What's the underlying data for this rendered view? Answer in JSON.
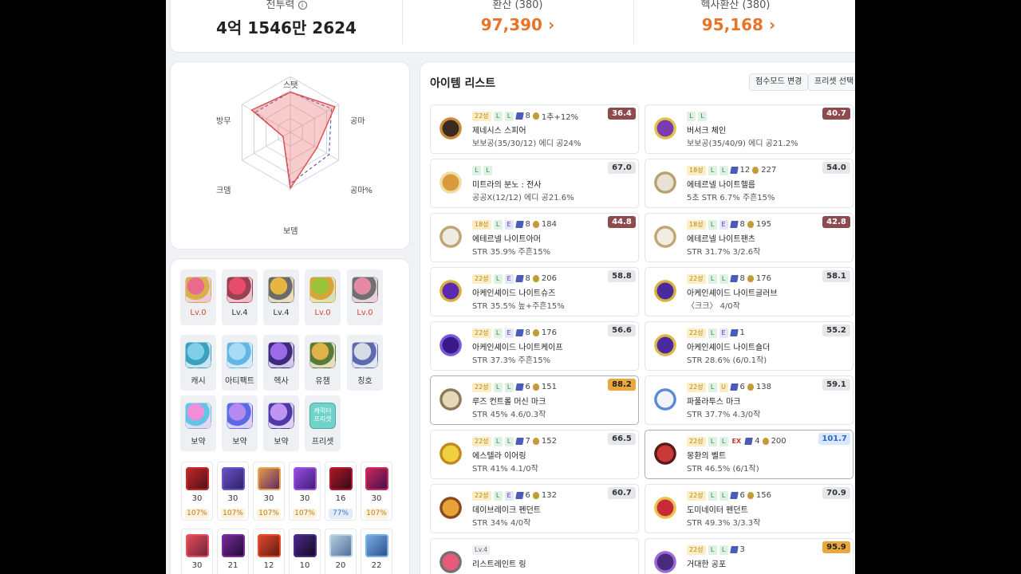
{
  "stats": [
    {
      "label": "전투력",
      "value": "4억 1546만 2624",
      "color": "dark",
      "info_icon": "info-circle-icon"
    },
    {
      "label": "환산 (380)",
      "value": "97,390",
      "color": "orange"
    },
    {
      "label": "헥사환산 (380)",
      "value": "95,168",
      "color": "orange"
    }
  ],
  "radar": {
    "axes": [
      "스탯",
      "공마",
      "공마%",
      "보뎀",
      "크뎀",
      "방무"
    ]
  },
  "equip_slots": [
    {
      "caption": "Lv.0",
      "color": "red",
      "icon": "ring-icon",
      "c1": "#e86a8c",
      "c2": "#d8b04a"
    },
    {
      "caption": "Lv.4",
      "color": "",
      "icon": "ring-icon",
      "c1": "#e54d6b",
      "c2": "#9a4052"
    },
    {
      "caption": "Lv.4",
      "color": "",
      "icon": "ring-icon",
      "c1": "#e6b640",
      "c2": "#6b6b6b"
    },
    {
      "caption": "Lv.0",
      "color": "red",
      "icon": "ring-icon",
      "c1": "#9ac53b",
      "c2": "#d8a53a"
    },
    {
      "caption": "Lv.0",
      "color": "red",
      "icon": "ring-icon",
      "c1": "#e58aa4",
      "c2": "#707070"
    },
    {
      "caption": "캐시",
      "color": "",
      "icon": "cash-icon",
      "c1": "#7fd0e6",
      "c2": "#3aa0c0"
    },
    {
      "caption": "아티팩트",
      "color": "",
      "icon": "artifact-icon",
      "c1": "#a8dcf6",
      "c2": "#62b6e3"
    },
    {
      "caption": "헥사",
      "color": "",
      "icon": "hexa-icon",
      "c1": "#9a6ae8",
      "c2": "#3b2b7a"
    },
    {
      "caption": "유챔",
      "color": "",
      "icon": "champion-icon",
      "c1": "#e0b24a",
      "c2": "#5a7a3a"
    },
    {
      "caption": "칭호",
      "color": "",
      "icon": "title-icon",
      "c1": "#d6dbe6",
      "c2": "#5d6ab0"
    },
    {
      "caption": "보약",
      "color": "",
      "icon": "potion-icon",
      "c1": "#f18ed9",
      "c2": "#5ec7e8"
    },
    {
      "caption": "보약",
      "color": "",
      "icon": "potion-icon",
      "c1": "#b58af0",
      "c2": "#5a6ae6"
    },
    {
      "caption": "보약",
      "color": "",
      "icon": "potion-icon",
      "c1": "#c094f0",
      "c2": "#4d3aa8"
    },
    {
      "caption": "프리셋",
      "color": "",
      "icon": "preset-icon",
      "c1": "#6fd3c9",
      "c2": "#4fa7a8",
      "text": "캐릭터 프리셋"
    }
  ],
  "skills": [
    {
      "lv": "30",
      "pct": "107%",
      "pc": "y",
      "c1": "#c6292b",
      "c2": "#4b0f13"
    },
    {
      "lv": "30",
      "pct": "107%",
      "pc": "y",
      "c1": "#6b55c9",
      "c2": "#2a1d63"
    },
    {
      "lv": "30",
      "pct": "107%",
      "pc": "y",
      "c1": "#e8a34b",
      "c2": "#5a1f63"
    },
    {
      "lv": "30",
      "pct": "107%",
      "pc": "y",
      "c1": "#9b4fe3",
      "c2": "#3a1a74"
    },
    {
      "lv": "16",
      "pct": "77%",
      "pc": "b",
      "c1": "#b5182d",
      "c2": "#2a0a12"
    },
    {
      "lv": "30",
      "pct": "107%",
      "pc": "y",
      "c1": "#cf2a5a",
      "c2": "#3b0e4f"
    },
    {
      "lv": "30",
      "c1": "#e8505a",
      "c2": "#6a1f3a"
    },
    {
      "lv": "21",
      "c1": "#7b2b9e",
      "c2": "#1e0b33"
    },
    {
      "lv": "12",
      "c1": "#e84a2a",
      "c2": "#5a1a12"
    },
    {
      "lv": "10",
      "c1": "#4b2a8a",
      "c2": "#12081f"
    },
    {
      "lv": "20",
      "c1": "#bcd2e6",
      "c2": "#4a6b94"
    },
    {
      "lv": "22",
      "c1": "#7ab1e6",
      "c2": "#2a4a8a"
    }
  ],
  "item_list": {
    "title": "아이템 리스트",
    "btn_score_mode": "점수모드 변경",
    "btn_preset": "프리셋 선택",
    "items": [
      {
        "star": "22성",
        "pots": [
          "L",
          "L"
        ],
        "scroll": "8",
        "flame": "1추+12%",
        "name": "제네시스 스피어",
        "sub": "보보공(35/30/12) 에디 공24%",
        "score": "36.4",
        "sc": "red",
        "icon": "spear-icon",
        "c1": "#3a2a22",
        "c2": "#c98a3a"
      },
      {
        "pots": [
          "L",
          "L"
        ],
        "name": "버서크 체인",
        "sub": "보보공(35/40/9) 에디 공21.2%",
        "score": "40.7",
        "sc": "red",
        "icon": "chain-icon",
        "c1": "#7a3ab0",
        "c2": "#e0c24a"
      },
      {
        "pots": [
          "L",
          "L"
        ],
        "name": "미트라의 분노 : 전사",
        "sub": "공공X(12/12) 에디 공21.6%",
        "score": "67.0",
        "sc": "gray",
        "icon": "emblem-icon",
        "c1": "#d89a3a",
        "c2": "#f2dba4"
      },
      {
        "star": "18성",
        "pots": [
          "L",
          "L"
        ],
        "scroll": "12",
        "flame": "227",
        "name": "에테르넬 나이트헬름",
        "sub": "5초 STR 6.7%  주흔15%",
        "score": "54.0",
        "sc": "gray",
        "icon": "helmet-icon",
        "c1": "#e8e2d6",
        "c2": "#b8a070"
      },
      {
        "star": "18성",
        "pots": [
          "L",
          "E"
        ],
        "scroll": "8",
        "flame": "184",
        "name": "에테르넬 나이트아머",
        "sub": "STR 35.9%  주흔15%",
        "score": "44.8",
        "sc": "red",
        "icon": "armor-icon",
        "c1": "#f0ebe0",
        "c2": "#bfa474"
      },
      {
        "star": "18성",
        "pots": [
          "L",
          "E"
        ],
        "scroll": "8",
        "flame": "195",
        "name": "에테르넬 나이트팬츠",
        "sub": "STR 31.7%  3/2.6작",
        "score": "42.8",
        "sc": "red",
        "icon": "pants-icon",
        "c1": "#f2ede2",
        "c2": "#c2a676"
      },
      {
        "star": "22성",
        "pots": [
          "L",
          "E"
        ],
        "scroll": "8",
        "flame": "206",
        "name": "아케인셰이드 나이트슈즈",
        "sub": "STR 35.5%  높+주흔15%",
        "score": "58.8",
        "sc": "gray",
        "icon": "shoes-icon",
        "c1": "#5a2ab0",
        "c2": "#d8b040"
      },
      {
        "star": "22성",
        "pots": [
          "L",
          "L"
        ],
        "scroll": "8",
        "flame": "176",
        "name": "아케인셰이드 나이트글러브",
        "sub": "〈크크〉 4/0작",
        "score": "58.1",
        "sc": "gray",
        "icon": "glove-icon",
        "c1": "#4a2a9e",
        "c2": "#d8b040"
      },
      {
        "star": "22성",
        "pots": [
          "L",
          "E"
        ],
        "scroll": "8",
        "flame": "176",
        "name": "아케인셰이드 나이트케이프",
        "sub": "STR 37.3%  주흔15%",
        "score": "56.6",
        "sc": "gray",
        "icon": "cape-icon",
        "c1": "#3a1a8a",
        "c2": "#7a5ad8"
      },
      {
        "star": "22성",
        "pots": [
          "L",
          "E"
        ],
        "scroll": "1",
        "name": "아케인셰이드 나이트숄더",
        "sub": "STR 28.6%  (6/0.1작)",
        "score": "55.2",
        "sc": "gray",
        "icon": "shoulder-icon",
        "c1": "#4a2a9e",
        "c2": "#e0b84a"
      },
      {
        "star": "22성",
        "pots": [
          "L",
          "L"
        ],
        "scroll": "6",
        "flame": "151",
        "name": "루즈 컨트롤 머신 마크",
        "sub": "STR 45%  4.6/0.3작",
        "score": "88.2",
        "sc": "gold",
        "hl": true,
        "icon": "badge-icon",
        "c1": "#e6d8b8",
        "c2": "#8a7a5a"
      },
      {
        "star": "22성",
        "pots": [
          "L",
          "U"
        ],
        "scroll": "6",
        "flame": "138",
        "name": "파풀라투스 마크",
        "sub": "STR 37.7%  4.3/0작",
        "score": "59.1",
        "sc": "gray",
        "icon": "badge-icon",
        "c1": "#f2f4f7",
        "c2": "#5a8ad8"
      },
      {
        "star": "22성",
        "pots": [
          "L",
          "L"
        ],
        "scroll": "7",
        "flame": "152",
        "name": "에스텔라 이어링",
        "sub": "STR 41%  4.1/0작",
        "score": "66.5",
        "sc": "gray",
        "icon": "earring-icon",
        "c1": "#f0d040",
        "c2": "#c08a20"
      },
      {
        "star": "22성",
        "pots": [
          "L",
          "L"
        ],
        "ex": "EX",
        "scroll": "4",
        "flame": "200",
        "name": "몽환의 벨트",
        "sub": "STR 46.5%  (6/1작)",
        "score": "101.7",
        "sc": "blue",
        "hl": true,
        "icon": "belt-icon",
        "c1": "#c83a3a",
        "c2": "#5a1a1a"
      },
      {
        "star": "22성",
        "pots": [
          "L",
          "E"
        ],
        "scroll": "6",
        "flame": "132",
        "name": "데이브레이크 펜던트",
        "sub": "STR 34%  4/0작",
        "score": "60.7",
        "sc": "gray",
        "icon": "pendant-icon",
        "c1": "#e8a23a",
        "c2": "#8a4a1a"
      },
      {
        "star": "22성",
        "pots": [
          "L",
          "L"
        ],
        "scroll": "6",
        "flame": "156",
        "name": "도미네이터 펜던트",
        "sub": "STR 49.3%  3/3.3작",
        "score": "70.9",
        "sc": "gray",
        "icon": "pendant-icon",
        "c1": "#c82a3a",
        "c2": "#e8c24a"
      },
      {
        "lv": "Lv.4",
        "name": "리스트레인트 링",
        "sub": "",
        "score": "",
        "sc": "gray",
        "icon": "ring-icon",
        "c1": "#e85a7a",
        "c2": "#707070"
      },
      {
        "star": "22성",
        "pots": [
          "L",
          "L"
        ],
        "scroll": "3",
        "name": "거대한 공포",
        "sub": "",
        "score": "95.9",
        "sc": "gold",
        "icon": "pocket-icon",
        "c1": "#4a2a7a",
        "c2": "#9a6ad8"
      }
    ]
  }
}
